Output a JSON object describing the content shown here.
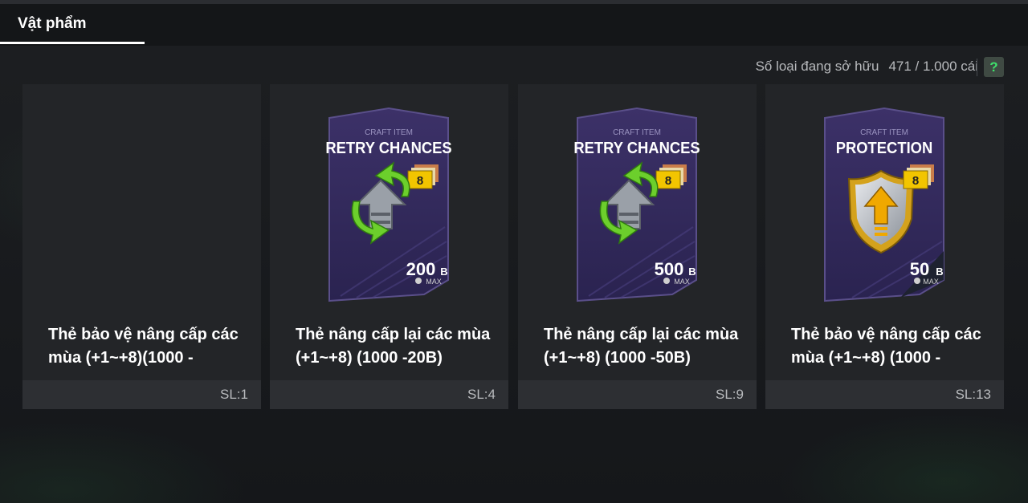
{
  "tabs": [
    {
      "label": "Vật phẩm"
    }
  ],
  "owned": {
    "label": "Số loại đang sở hữu",
    "count": "471 / 1.000 cái"
  },
  "help": {
    "label": "?"
  },
  "items": [
    {
      "name": "Thẻ bảo vệ nâng cấp các mùa (+1~+8)(1000 -",
      "qty": "SL:1",
      "image": "none"
    },
    {
      "name": "Thẻ nâng cấp lại các mùa (+1~+8) (1000 -20B)",
      "qty": "SL:4",
      "image": "retry-chances-card",
      "card": {
        "subtitle": "CRAFT ITEM",
        "title": "RETRY CHANCES",
        "level": "8",
        "amount": "200",
        "unit": "B",
        "max": "MAX"
      }
    },
    {
      "name": "Thẻ nâng cấp lại các mùa (+1~+8) (1000 -50B)",
      "qty": "SL:9",
      "image": "retry-chances-card",
      "card": {
        "subtitle": "CRAFT ITEM",
        "title": "RETRY CHANCES",
        "level": "8",
        "amount": "500",
        "unit": "B",
        "max": "MAX"
      }
    },
    {
      "name": "Thẻ bảo vệ nâng cấp các mùa (+1~+8) (1000 -",
      "qty": "SL:13",
      "image": "protection-card",
      "card": {
        "subtitle": "CRAFT ITEM",
        "title": "PROTECTION",
        "level": "8",
        "amount": "50",
        "unit": "B",
        "max": "MAX"
      }
    }
  ],
  "colors": {
    "tab_underline": "#ffffff",
    "help_icon": "#3fe06c",
    "card_bg": "#3a2f63",
    "level_badge": "#f2c500",
    "arrow_green": "#6ccf2c"
  }
}
